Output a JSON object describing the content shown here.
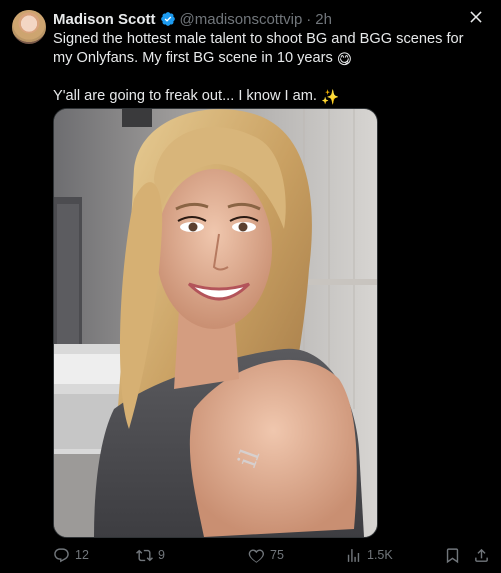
{
  "author": {
    "name": "Madison Scott",
    "handle": "@madisonscottvip",
    "time": "2h",
    "separator": "·",
    "verified": true
  },
  "tweet": {
    "line1": "Signed the hottest male talent to shoot BG and BGG scenes for my Onlyfans. My first BG scene in 10 years",
    "emoji1": "😋",
    "line2": "Y'all are going to freak out... I know I am.",
    "emoji2": "✨"
  },
  "media": {
    "type": "photo"
  },
  "actions": {
    "replies": "12",
    "reposts": "9",
    "likes": "75",
    "views": "1.5K"
  },
  "colors": {
    "background": "#000000",
    "text": "#e7e9ea",
    "muted": "#71767b",
    "verified": "#1d9bf0"
  },
  "icons": [
    "more-icon",
    "verified-icon",
    "reply-icon",
    "repost-icon",
    "like-icon",
    "views-icon",
    "bookmark-icon",
    "share-icon"
  ]
}
